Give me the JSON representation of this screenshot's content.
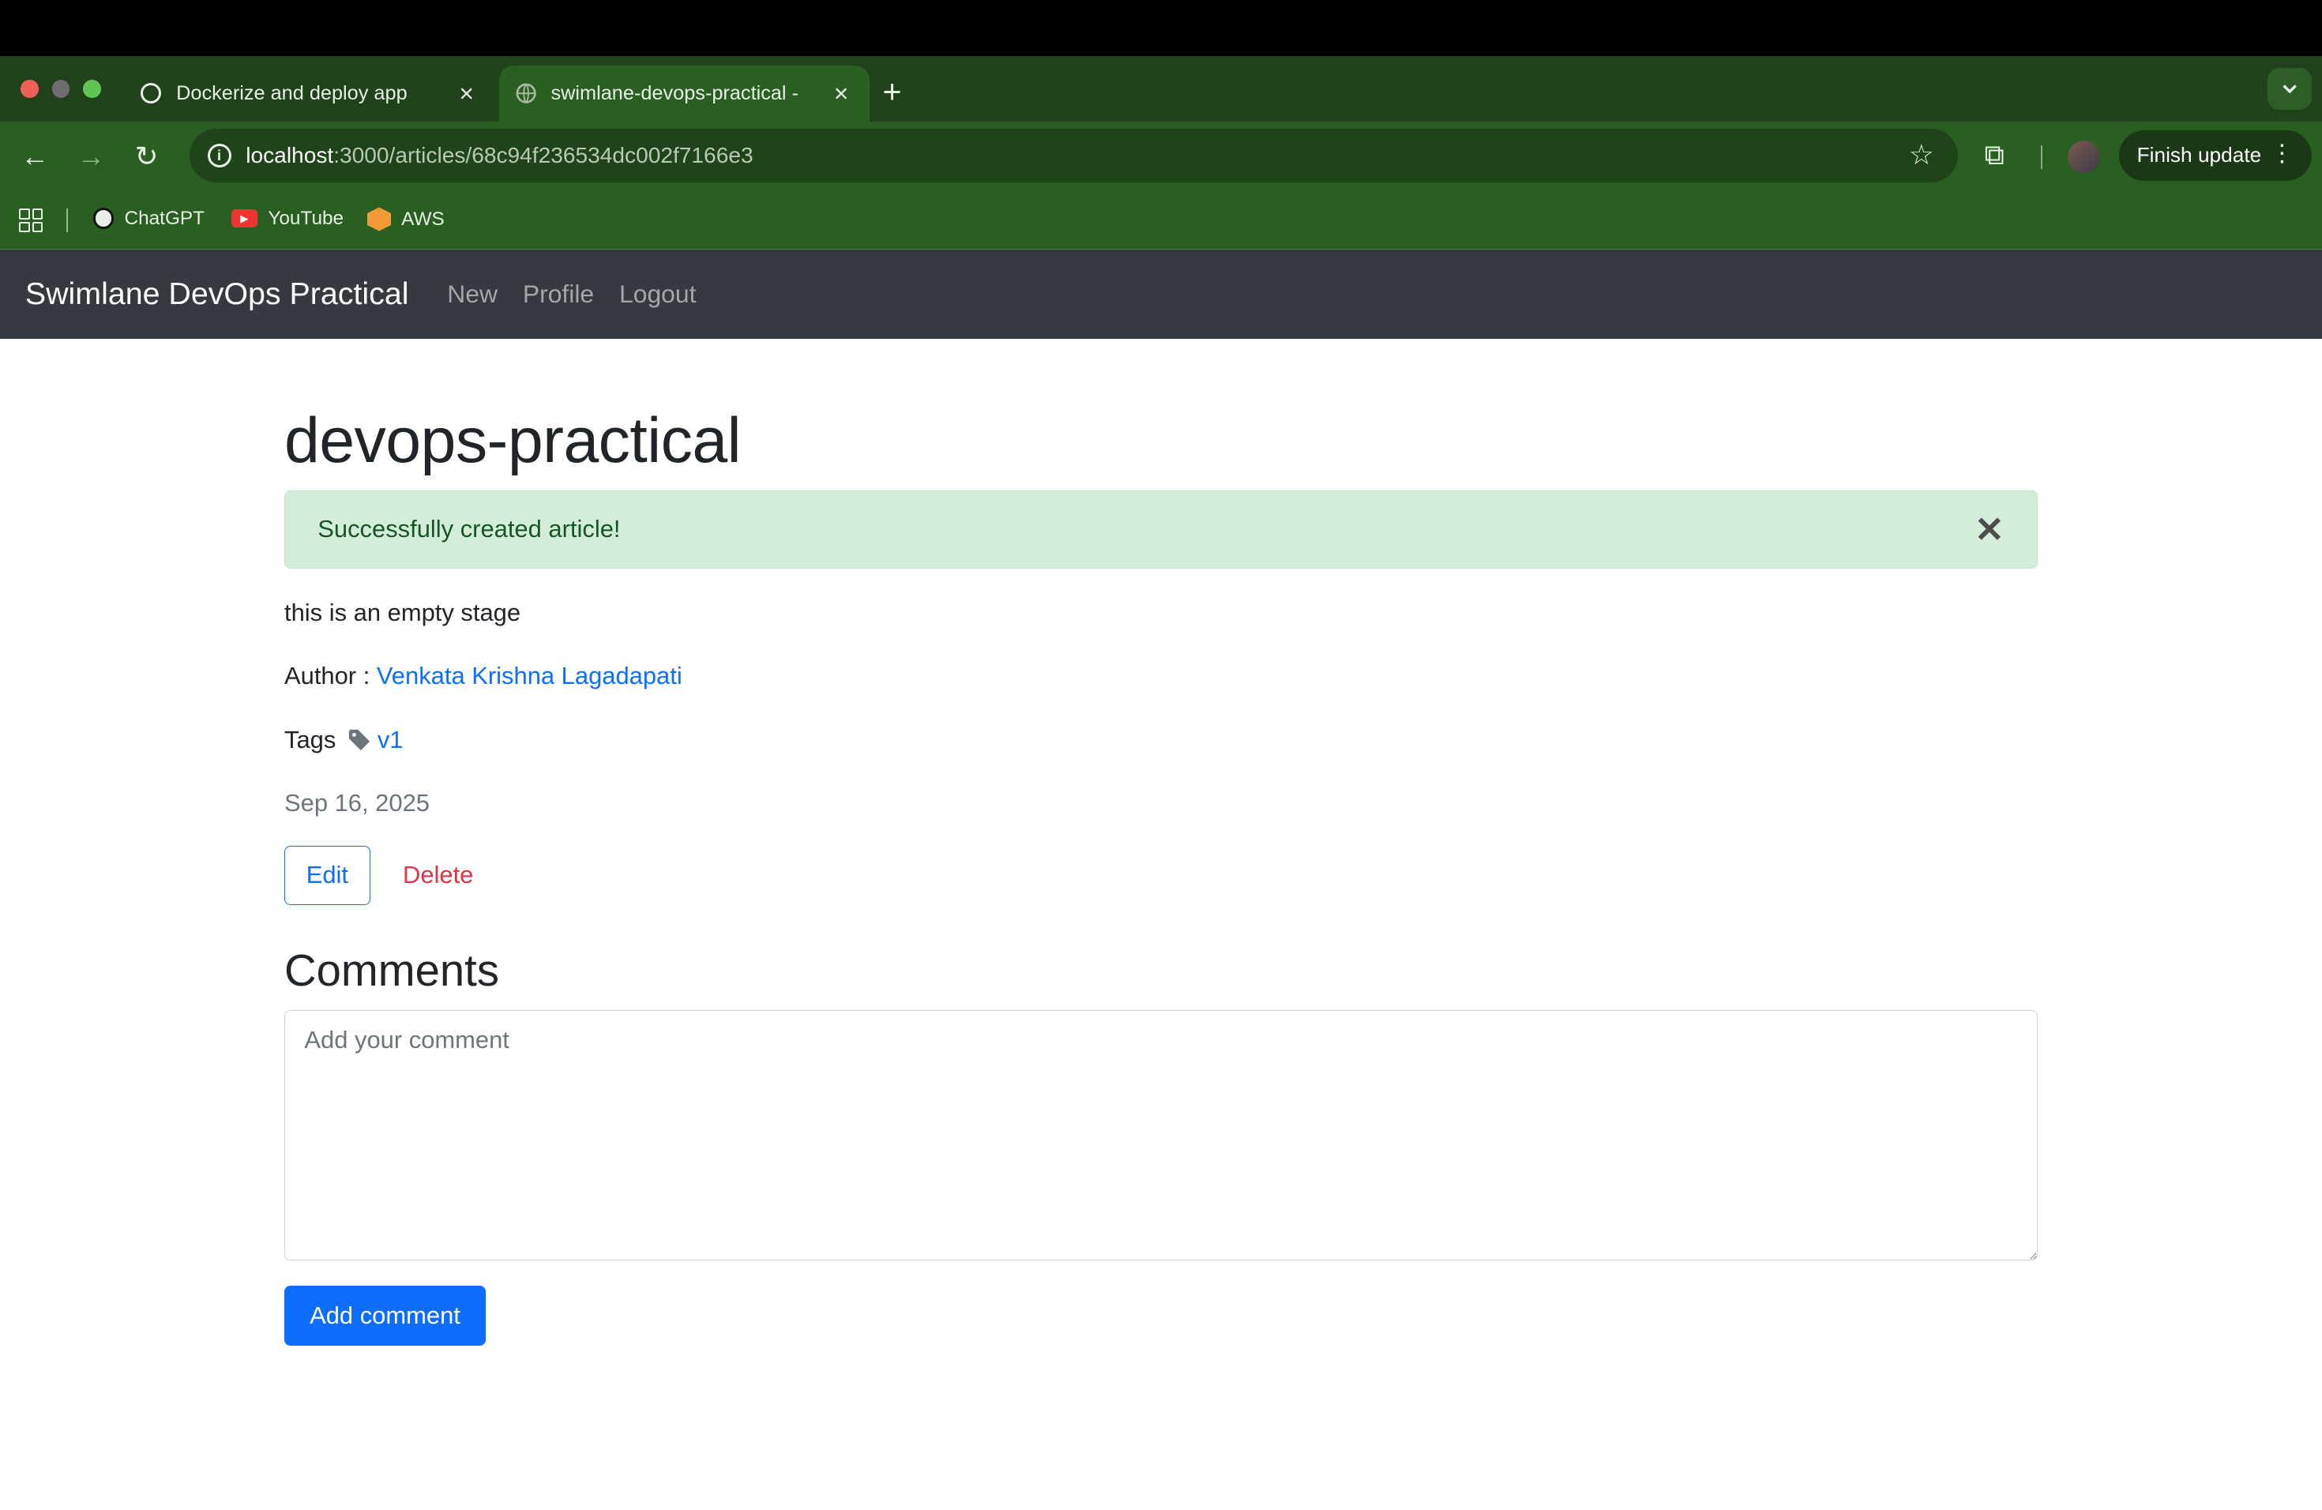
{
  "browser": {
    "tabs": [
      {
        "title": "Dockerize and deploy app",
        "active": false
      },
      {
        "title": "swimlane-devops-practical - ",
        "active": true
      }
    ],
    "url_host": "localhost",
    "url_path": ":3000/articles/68c94f236534dc002f7166e3",
    "finish_update": "Finish update",
    "bookmarks": [
      "ChatGPT",
      "YouTube",
      "AWS"
    ]
  },
  "appnav": {
    "brand": "Swimlane DevOps Practical",
    "links": [
      "New",
      "Profile",
      "Logout"
    ]
  },
  "article": {
    "title": "devops-practical",
    "alert": "Successfully created article!",
    "alert_close": "✕",
    "body": "this is an empty stage",
    "author_label": "Author : ",
    "author_name": "Venkata Krishna Lagadapati",
    "tags_label": "Tags",
    "tag": "v1",
    "date": "Sep 16, 2025",
    "edit_label": "Edit",
    "delete_label": "Delete"
  },
  "comments": {
    "heading": "Comments",
    "placeholder": "Add your comment",
    "submit_label": "Add comment"
  }
}
